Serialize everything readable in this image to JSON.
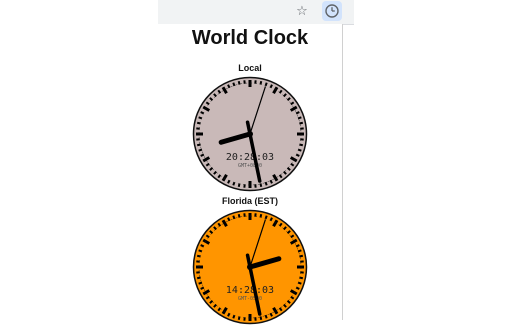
{
  "browser": {
    "bookmark_icon": "star-icon",
    "extension_icon": "clock-icon",
    "bookmark_glyph": "☆"
  },
  "popup": {
    "title": "World Clock",
    "clocks": [
      {
        "label": "Local",
        "digital_time": "20:28:03",
        "timezone": "GMT+0800",
        "hours": 20,
        "minutes": 28,
        "seconds": 3,
        "face_color": "#c9b9b8"
      },
      {
        "label": "Florida (EST)",
        "digital_time": "14:28:03",
        "timezone": "GMT-0500",
        "hours": 14,
        "minutes": 28,
        "seconds": 3,
        "face_color": "#ff9500"
      }
    ]
  }
}
